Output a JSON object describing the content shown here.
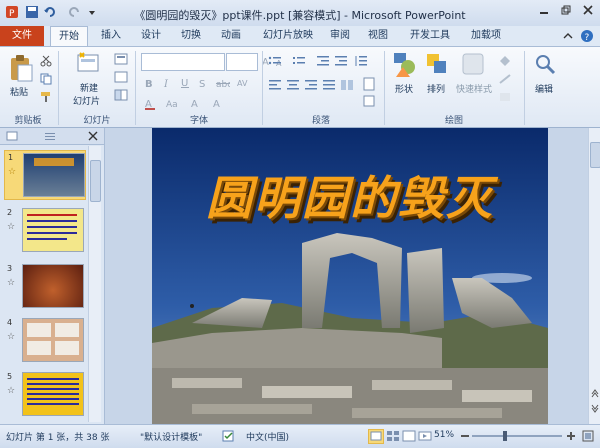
{
  "title_bar": {
    "title": "《圆明园的毁灭》ppt课件.ppt [兼容模式] - Microsoft PowerPoint"
  },
  "tabs": [
    {
      "label": "文件"
    },
    {
      "label": "开始"
    },
    {
      "label": "插入"
    },
    {
      "label": "设计"
    },
    {
      "label": "切换"
    },
    {
      "label": "动画"
    },
    {
      "label": "幻灯片放映"
    },
    {
      "label": "审阅"
    },
    {
      "label": "视图"
    },
    {
      "label": "开发工具"
    },
    {
      "label": "加载项"
    }
  ],
  "ribbon": {
    "clipboard": {
      "paste": "粘贴",
      "group": "剪贴板"
    },
    "slides": {
      "new_slide_1": "新建",
      "new_slide_2": "幻灯片",
      "group": "幻灯片"
    },
    "font": {
      "group": "字体"
    },
    "paragraph": {
      "group": "段落"
    },
    "drawing": {
      "shape": "形状",
      "arrange": "排列",
      "quick_style": "快速样式",
      "group": "绘图"
    },
    "editing": {
      "label": "编辑"
    }
  },
  "slide_pane": {
    "thumbnails": [
      {
        "num": "1",
        "color": "#3a5d8c"
      },
      {
        "num": "2",
        "color": "#f3e78a"
      },
      {
        "num": "3",
        "color": "#8a3b22"
      },
      {
        "num": "4",
        "color": "#d9b08f"
      },
      {
        "num": "5",
        "color": "#f2c21a"
      }
    ]
  },
  "slide": {
    "title": "圆明园的毁灭"
  },
  "status_bar": {
    "slide_info": "幻灯片 第 1 张，共 38 张",
    "theme": "\"默认设计模板\"",
    "language": "中文(中国)",
    "zoom": "51%"
  },
  "colors": {
    "file_tab": "#c9421c",
    "title_text": "#f7a21b"
  }
}
